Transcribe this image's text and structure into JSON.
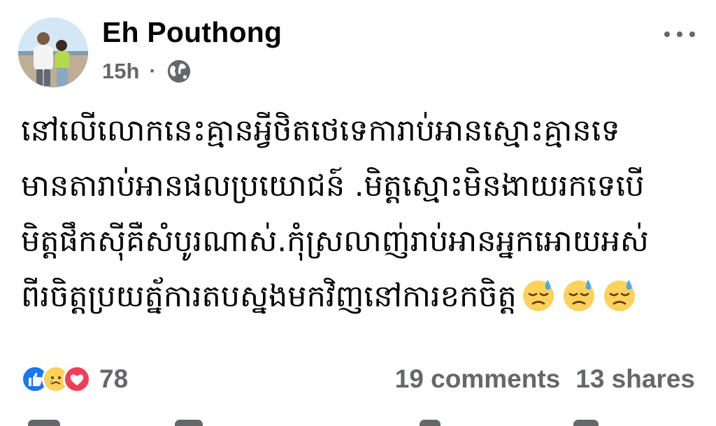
{
  "post": {
    "author": "Eh Pouthong",
    "time": "15h",
    "separator": "·",
    "privacy_icon": "globe-icon",
    "more_icon": "more-horizontal-icon",
    "body_lines": [
      "នៅលើលោកនេះគ្មានអ្វីថិតថេទេការាប់អានស្មោះគ្មានទេ",
      "មានតារាប់អានផលប្រយោជន៍ .មិត្តស្មោះមិនងាយរកទេបើ",
      "មិត្តផឹកស៊ីគឺសំបូរណាស់.កុំស្រលាញ់រាប់អានអ្នកអោយអស់",
      "ពីរចិត្តប្រយត្ន័ការតបស្នងមកវិញនៅការខកចិត្ត"
    ],
    "emoji": [
      "downcast-face-with-sweat",
      "downcast-face-with-sweat",
      "downcast-face-with-sweat"
    ]
  },
  "engagement": {
    "reaction_icons": [
      "like-icon",
      "sad-icon",
      "love-icon"
    ],
    "reaction_count": "78",
    "comments": "19 comments",
    "shares": "13 shares"
  },
  "colors": {
    "text": "#050505",
    "secondary": "#65676b",
    "like": "#1877f2",
    "love": "#f33e58",
    "emoji_yellow": "#fdd15a",
    "sweat": "#4fa8e8"
  }
}
